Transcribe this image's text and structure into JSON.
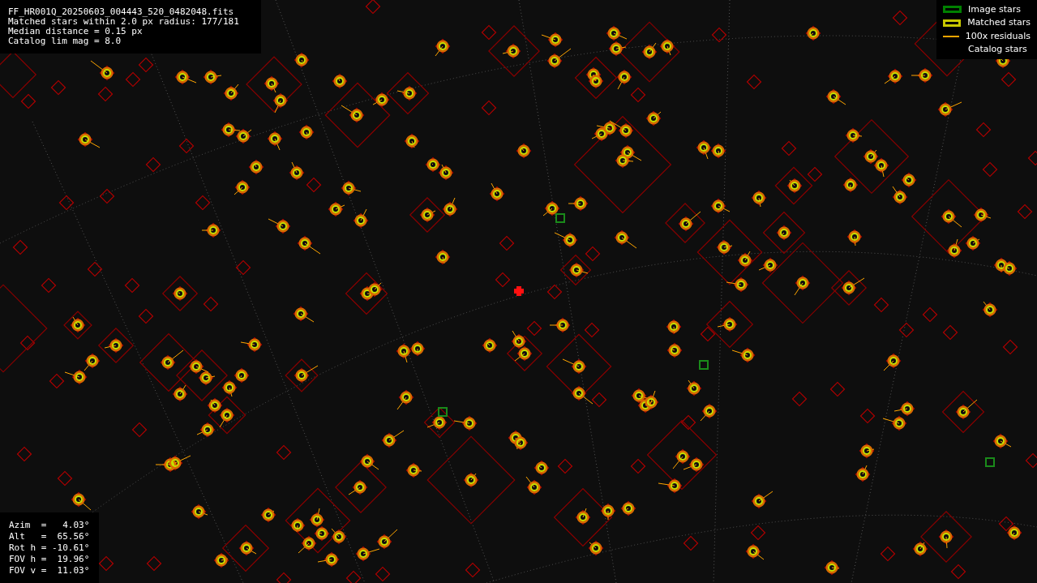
{
  "info_lines": [
    "FF_HR001Q_20250603_004443_520_0482048.fits",
    "Matched stars within 2.0 px radius: 177/181",
    "Median distance = 0.15 px",
    "Catalog lim mag = 8.0"
  ],
  "legend": [
    {
      "kind": "box",
      "color": "#008000",
      "label": "Image stars"
    },
    {
      "kind": "box",
      "color": "#c8c800",
      "label": "Matched stars"
    },
    {
      "kind": "line",
      "color": "#ffa500",
      "label": "100x residuals"
    },
    {
      "kind": "none",
      "label": "Catalog stars"
    }
  ],
  "pointing": [
    "Azim  =   4.03°",
    "Alt   =  65.56°",
    "Rot h = -10.61°",
    "FOV h =  19.96°",
    "FOV v =  11.03°"
  ]
}
